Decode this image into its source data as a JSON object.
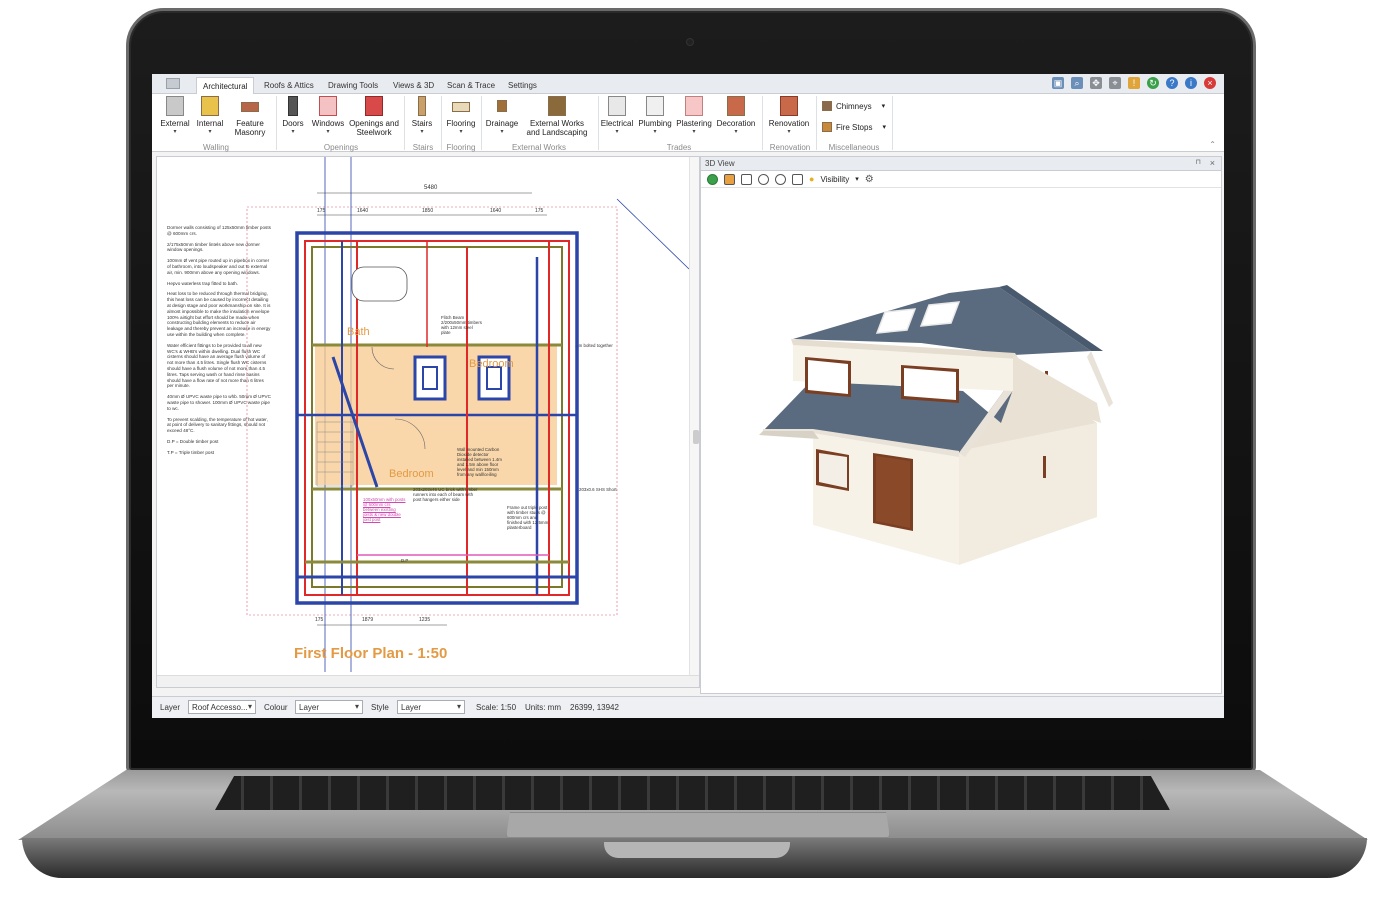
{
  "tabs": [
    "Architectural",
    "Roofs & Attics",
    "Drawing Tools",
    "Views & 3D",
    "Scan & Trace",
    "Settings"
  ],
  "active_tab": "Architectural",
  "ribbon": {
    "external": "External",
    "internal": "Internal",
    "feature_masonry": "Feature\nMasonry",
    "doors": "Doors",
    "windows": "Windows",
    "openings_steelwork": "Openings and\nSteelwork",
    "stairs": "Stairs",
    "flooring": "Flooring",
    "drainage": "Drainage",
    "external_works": "External Works\nand Landscaping",
    "electrical": "Electrical",
    "plumbing": "Plumbing",
    "plastering": "Plastering",
    "decoration": "Decoration",
    "renovation": "Renovation",
    "chimneys": "Chimneys",
    "fire_stops": "Fire Stops",
    "groups": {
      "walling": "Walling",
      "openings": "Openings",
      "stairs": "Stairs",
      "flooring": "Flooring",
      "external_works": "External Works",
      "trades": "Trades",
      "renovation": "Renovation",
      "miscellaneous": "Miscellaneous"
    }
  },
  "plan": {
    "title": "First Floor Plan - 1:50",
    "dim_total": "5480",
    "dims_top": [
      "175",
      "1640",
      "1850",
      "1640",
      "175"
    ],
    "dims_bottom": [
      "175",
      "1879",
      "1235"
    ],
    "rooms": [
      "Bath",
      "Bedroom",
      "Bedroom"
    ],
    "notes": [
      "Dormer walls consisting of 125x50mm timber posts @ 600mm crs.",
      "2/175x50mm timber lintels above new dormer window openings.",
      "100mm Ø vent pipe routed up in pipebox in corner of bathroom, into loudspeaker and out to external air, min. 900mm above any opening windows.",
      "Hepvo waterless trap fitted to bath.",
      "Heat loss to be reduced through thermal bridging, this heat loss can be caused by incorrect detailing at design stage and poor workmanship on site. It is almost impossible to make the insulation envelope 100% airtight but effort should be made when constructing building elements to reduce air leakage and thereby prevent an increase in energy use within the building when complete.",
      "Water efficient fittings to be provided to all new WC's & WHB's within dwelling. Dual flush WC cisterns should have an average flush volume of not more than 4.5 litres. Single flush WC cisterns should have a flush volume of not more than 4.5 litres. Taps serving wash or hand rinse basins should have a flow rate of not more than 6 litres per minute.",
      "40mm Ø UPVC waste pipe to whb. 50mm Ø UPVC waste pipe to shower. 100mm Ø UPVC waste pipe to wc.",
      "To prevent scalding, the temperature of hot water, at point of delivery to sanitary fittings, should not exceed 48°C.",
      "D.P = Double timber post",
      "T.P = Triple timber post"
    ],
    "annotations": {
      "flitch": "Flitch Beam\n2/200x50mm timbers\nwith 12mm steel\nplate",
      "smoke": "Wall mounted Carbon\nDioxide detector\ninstalled between 1.4m\nand 1.5m above floor\nlevel and min 150mm\nfrom any wall/ceiling",
      "uc": "203x203x46 UC brick with timber\nrunners into each of beam with\npost hangers either side",
      "purlin": "Frame out triple post\nwith timber studs @\n600mm crs and\nfinished with 12.5mm\nplasterboard",
      "pink": "100x50mm with posts\n@ 600mm crs\nbetween existing\njoists & new double\njoist post",
      "dp": "D.P",
      "shs": "203x0.6 SHS Short",
      "bolted": "...m bolted together"
    }
  },
  "view3d": {
    "title": "3D View",
    "visibility": "Visibility"
  },
  "status": {
    "layer_label": "Layer",
    "layer_value": "Roof Accesso...",
    "colour_label": "Colour",
    "colour_value": "Layer",
    "style_label": "Style",
    "style_value": "Layer",
    "scale": "Scale: 1:50",
    "units": "Units: mm",
    "coords": "26399, 13942"
  },
  "colors": {
    "accent_orange": "#e39a44",
    "wall_blue": "#2b45a8",
    "wall_red": "#e02828",
    "roof_slate": "#5b6b7f",
    "door_brown": "#7a3e22"
  }
}
